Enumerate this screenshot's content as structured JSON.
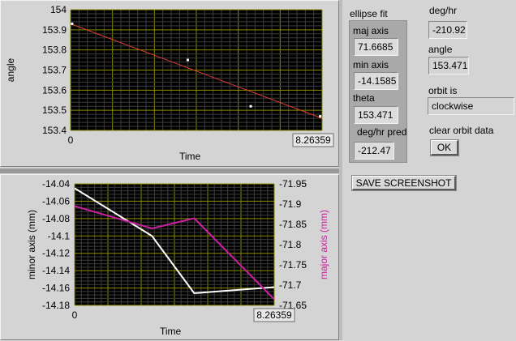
{
  "top_chart": {
    "ylabel": "angle",
    "xlabel": "Time",
    "ylim": [
      153.4,
      154
    ],
    "xlim": [
      0,
      8.26359
    ],
    "yticks": [
      "154",
      "153.9",
      "153.8",
      "153.7",
      "153.6",
      "153.5",
      "153.4"
    ],
    "xticks": [
      "0",
      "8.26359"
    ]
  },
  "bottom_chart": {
    "xlabel": "Time",
    "ylabel_left": "minor axis (mm)",
    "ylabel_right": "major axis (mm)",
    "ylim_left": [
      -14.18,
      -14.04
    ],
    "ylim_right": [
      -71.65,
      -71.95
    ],
    "yticks_left": [
      "-14.04",
      "-14.06",
      "-14.08",
      "-14.1",
      "-14.12",
      "-14.14",
      "-14.16",
      "-14.18"
    ],
    "yticks_right": [
      "-71.95",
      "-71.9",
      "-71.85",
      "-71.8",
      "-71.75",
      "-71.7",
      "-71.65"
    ],
    "xticks": [
      "0",
      "8.26359"
    ]
  },
  "chart_data": [
    {
      "type": "scatter",
      "xlabel": "Time",
      "ylabel": "angle",
      "xlim": [
        0,
        8.26359
      ],
      "ylim": [
        153.4,
        154
      ],
      "grid": true,
      "series": [
        {
          "points": [
            [
              0.05,
              153.93
            ],
            [
              3.85,
              153.75
            ],
            [
              5.92,
              153.52
            ],
            [
              8.2,
              153.47
            ]
          ],
          "color": "#ffffff"
        },
        {
          "type": "line",
          "points": [
            [
              0,
              153.93
            ],
            [
              8.26359,
              153.46
            ]
          ],
          "color": "#e03c31"
        }
      ]
    },
    {
      "type": "line",
      "xlabel": "Time",
      "ylabel": "minor axis (mm)",
      "y2label": "major axis (mm)",
      "xlim": [
        0,
        8.26359
      ],
      "ylim": [
        -14.18,
        -14.04
      ],
      "y2lim": [
        -71.95,
        -71.65
      ],
      "grid": true,
      "series": [
        {
          "axis": "left",
          "color": "#ffffff",
          "points": [
            [
              0,
              -14.045
            ],
            [
              3.2,
              -14.1
            ],
            [
              4.95,
              -14.166
            ],
            [
              8.26359,
              -14.159
            ]
          ]
        },
        {
          "axis": "right",
          "color": "#cc1fa0",
          "points": [
            [
              0,
              -71.895
            ],
            [
              3.2,
              -71.84
            ],
            [
              4.95,
              -71.865
            ],
            [
              8.26359,
              -71.665
            ]
          ]
        }
      ]
    }
  ],
  "ellipse_fit": {
    "title": "ellipse fit",
    "maj_axis_label": "maj axis",
    "maj_axis_value": "71.6685",
    "min_axis_label": "min axis",
    "min_axis_value": "-14.1585",
    "theta_label": "theta",
    "theta_value": "153.471",
    "deghr_pred_label": "deg/hr pred",
    "deghr_pred_value": "-212.47"
  },
  "right": {
    "deghr_label": "deg/hr",
    "deghr_value": "-210.92",
    "angle_label": "angle",
    "angle_value": "153.471",
    "orbit_label": "orbit is",
    "orbit_value": "clockwise",
    "clear_label": "clear orbit data",
    "ok_label": "OK"
  },
  "screenshot_button_label": "SAVE SCREENSHOT",
  "colors": {
    "plot_bg": "#000000",
    "grid": "#8b8b00",
    "minor_grid": "#3d3d3d",
    "frame_bg": "#d4d4d4"
  }
}
